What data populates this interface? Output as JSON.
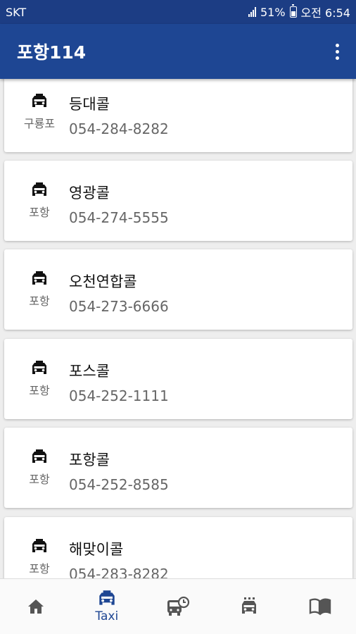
{
  "status": {
    "carrier": "SKT",
    "battery": "51%",
    "time": "오전 6:54"
  },
  "app": {
    "title": "포항114"
  },
  "cards": [
    {
      "name": "등대콜",
      "region": "구룡포",
      "phone": "054-284-8282"
    },
    {
      "name": "영광콜",
      "region": "포항",
      "phone": "054-274-5555"
    },
    {
      "name": "오천연합콜",
      "region": "포항",
      "phone": "054-273-6666"
    },
    {
      "name": "포스콜",
      "region": "포항",
      "phone": "054-252-1111"
    },
    {
      "name": "포항콜",
      "region": "포항",
      "phone": "054-252-8585"
    },
    {
      "name": "해맞이콜",
      "region": "포항",
      "phone": "054-283-8282"
    }
  ],
  "nav": [
    {
      "icon": "home-icon",
      "label": ""
    },
    {
      "icon": "taxi-icon",
      "label": "Taxi",
      "active": true
    },
    {
      "icon": "bus-schedule-icon",
      "label": ""
    },
    {
      "icon": "train-icon",
      "label": ""
    },
    {
      "icon": "book-icon",
      "label": ""
    }
  ],
  "colors": {
    "status_bar": "#1c3d84",
    "app_bar": "#1e4693",
    "accent": "#1e4693"
  }
}
